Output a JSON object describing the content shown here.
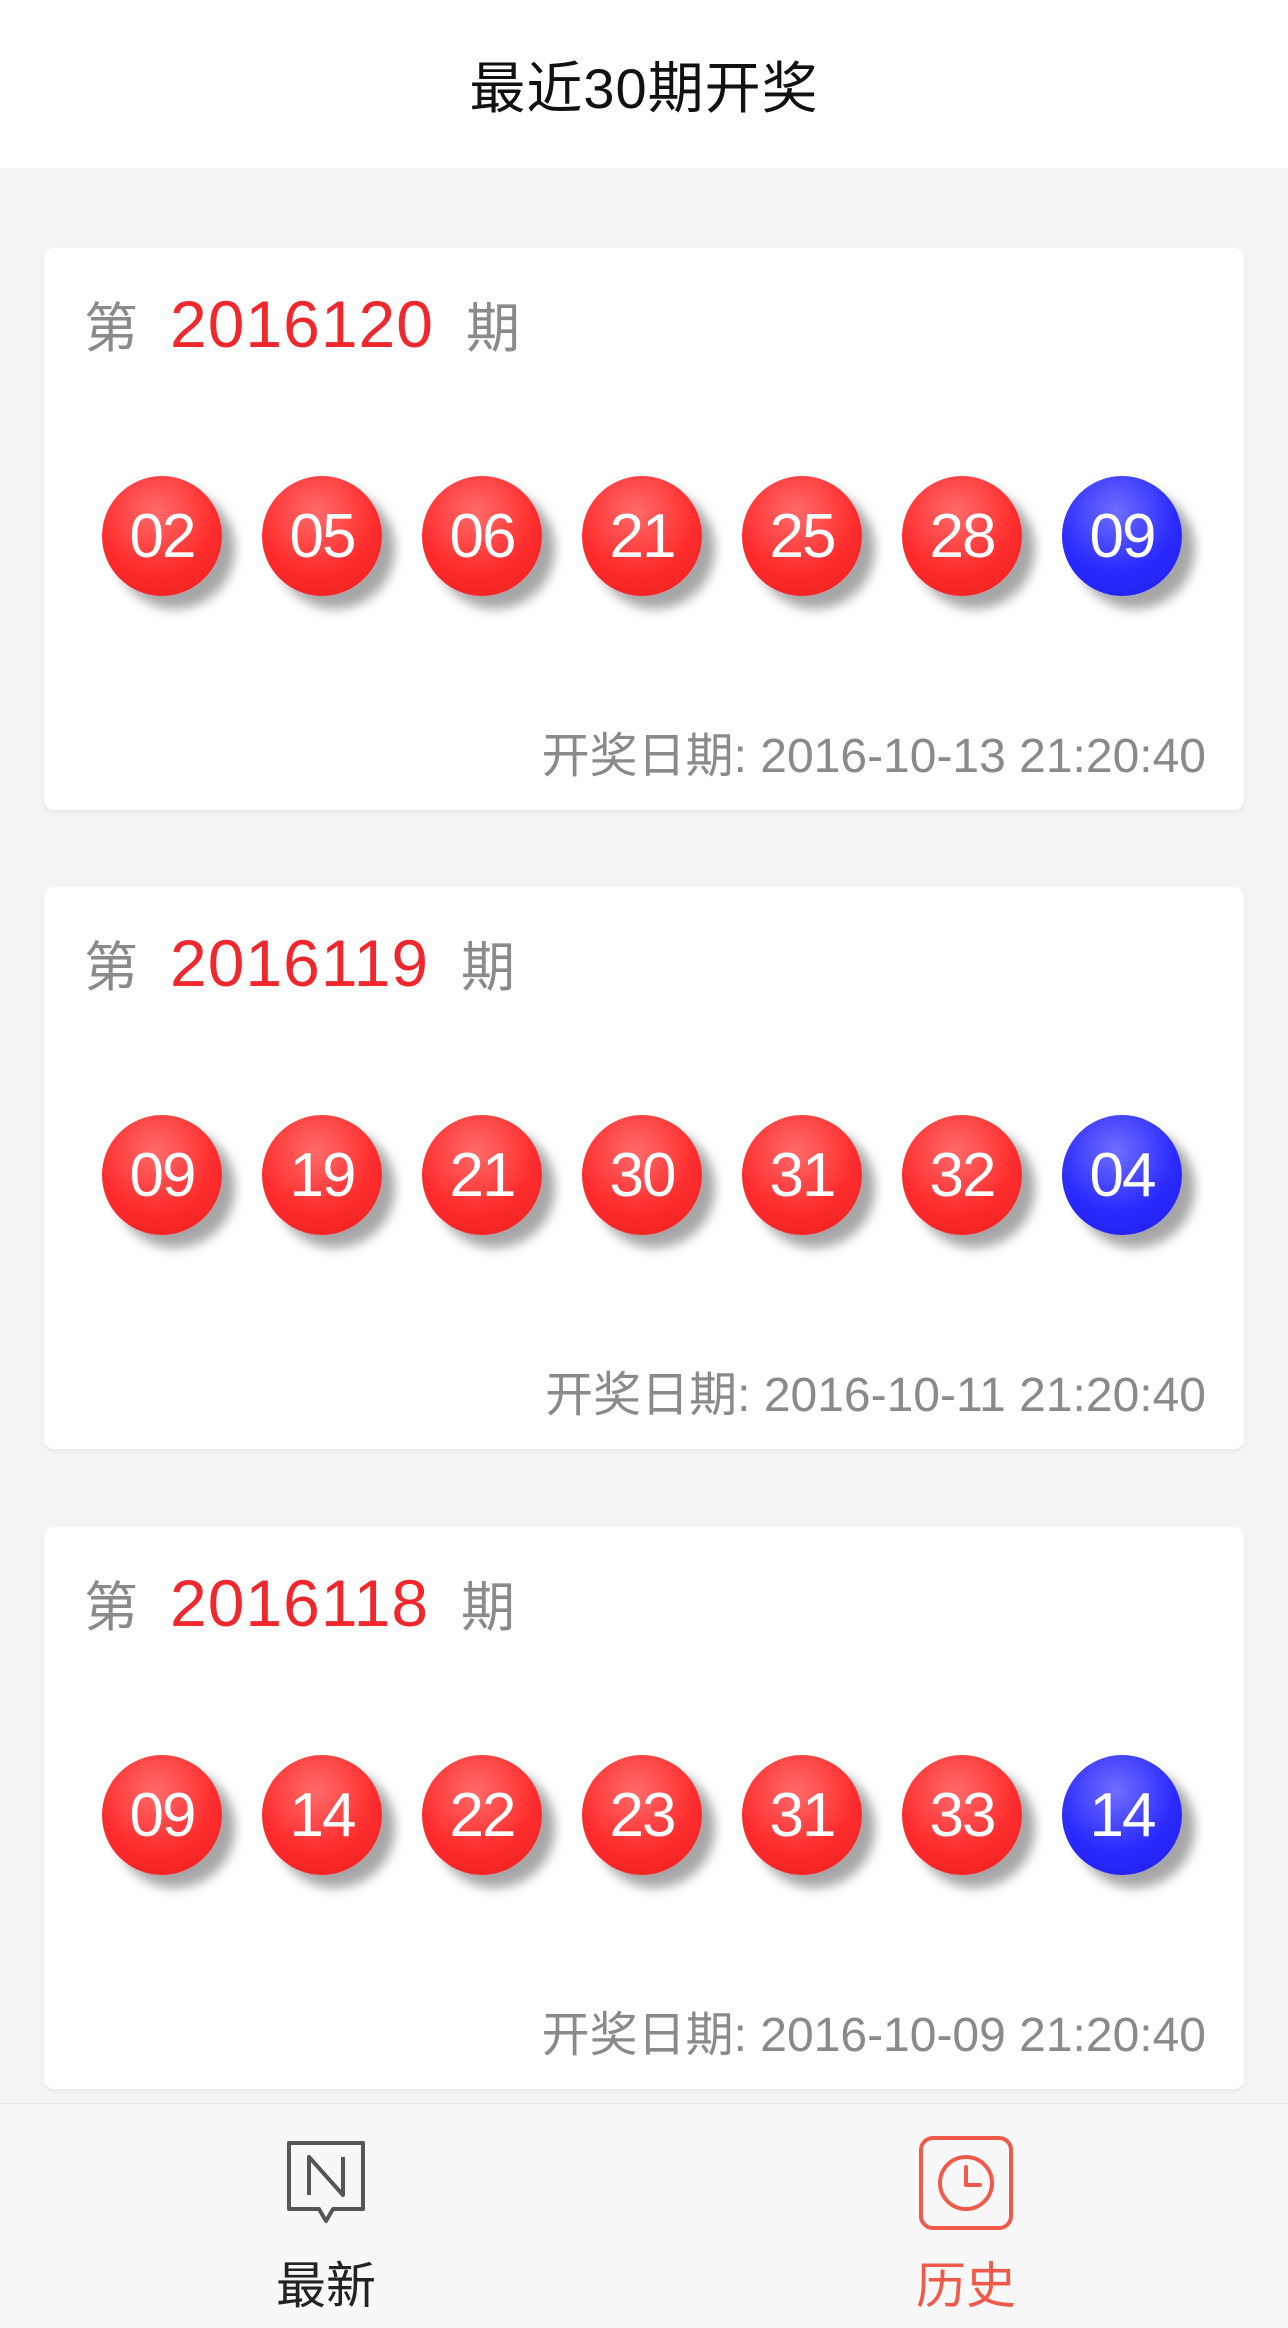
{
  "header": {
    "title": "最近30期开奖"
  },
  "draws": [
    {
      "prefix": "第",
      "issue": "2016120",
      "suffix": "期",
      "red": [
        "02",
        "05",
        "06",
        "21",
        "25",
        "28"
      ],
      "blue": "09",
      "date_label": "开奖日期:",
      "date": "2016-10-13 21:20:40"
    },
    {
      "prefix": "第",
      "issue": "2016119",
      "suffix": "期",
      "red": [
        "09",
        "19",
        "21",
        "30",
        "31",
        "32"
      ],
      "blue": "04",
      "date_label": "开奖日期:",
      "date": "2016-10-11 21:20:40"
    },
    {
      "prefix": "第",
      "issue": "2016118",
      "suffix": "期",
      "red": [
        "09",
        "14",
        "22",
        "23",
        "31",
        "33"
      ],
      "blue": "14",
      "date_label": "开奖日期:",
      "date": "2016-10-09 21:20:40"
    }
  ],
  "tabbar": {
    "items": [
      {
        "label": "最新",
        "icon": "news-icon",
        "active": false
      },
      {
        "label": "历史",
        "icon": "clock-icon",
        "active": true
      }
    ]
  },
  "colors": {
    "accent": "#f0282d",
    "red_ball": "#ff2d2d",
    "blue_ball": "#2b2bff",
    "active_tab": "#f05a4a",
    "muted_text": "#8a8a8a"
  }
}
